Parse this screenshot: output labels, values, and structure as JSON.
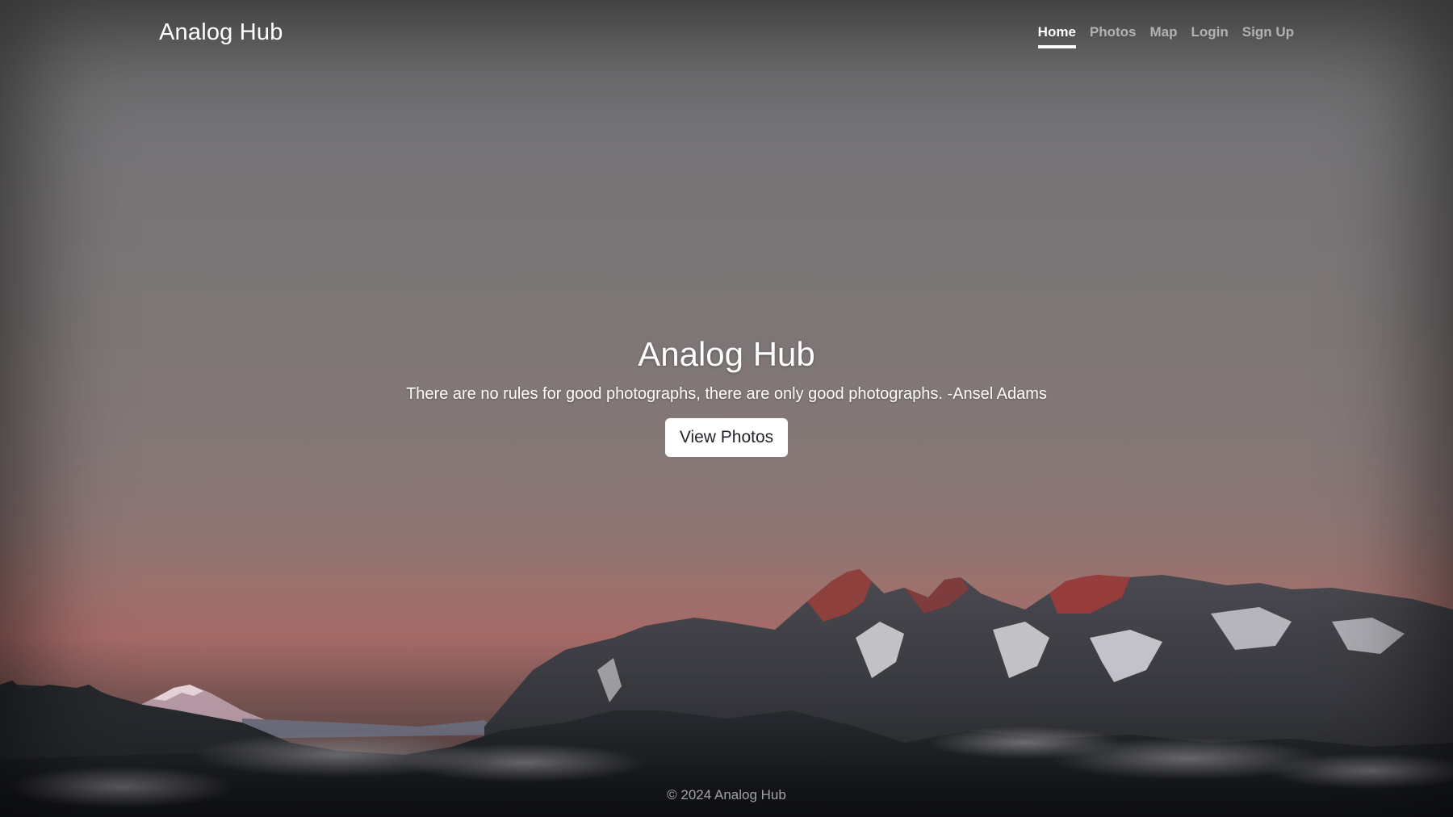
{
  "header": {
    "brand": "Analog Hub",
    "nav": [
      {
        "label": "Home",
        "active": true
      },
      {
        "label": "Photos",
        "active": false
      },
      {
        "label": "Map",
        "active": false
      },
      {
        "label": "Login",
        "active": false
      },
      {
        "label": "Sign Up",
        "active": false
      }
    ]
  },
  "hero": {
    "title": "Analog Hub",
    "quote": "There are no rules for good photographs, there are only good photographs. -Ansel Adams",
    "button_label": "View Photos"
  },
  "footer": {
    "text": "© 2024 Analog Hub"
  },
  "colors": {
    "sky_top": "#6c6b6d",
    "sunset_glow": "#a56a68",
    "mountain_dark": "#2a2d33",
    "button_bg": "#ffffff",
    "nav_active": "#ffffff"
  }
}
